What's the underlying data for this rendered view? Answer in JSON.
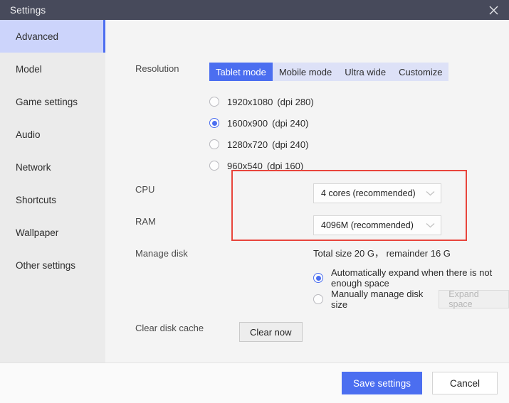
{
  "window": {
    "title": "Settings",
    "close_icon": "close-icon"
  },
  "sidebar": {
    "items": [
      {
        "label": "Advanced",
        "active": true
      },
      {
        "label": "Model",
        "active": false
      },
      {
        "label": "Game settings",
        "active": false
      },
      {
        "label": "Audio",
        "active": false
      },
      {
        "label": "Network",
        "active": false
      },
      {
        "label": "Shortcuts",
        "active": false
      },
      {
        "label": "Wallpaper",
        "active": false
      },
      {
        "label": "Other settings",
        "active": false
      }
    ]
  },
  "main": {
    "resolution": {
      "label": "Resolution",
      "tabs": [
        {
          "label": "Tablet mode",
          "active": true
        },
        {
          "label": "Mobile mode",
          "active": false
        },
        {
          "label": "Ultra wide",
          "active": false
        },
        {
          "label": "Customize",
          "active": false
        }
      ],
      "options": [
        {
          "size": "1920x1080",
          "dpi": "(dpi 280)",
          "selected": false
        },
        {
          "size": "1600x900",
          "dpi": "(dpi 240)",
          "selected": true
        },
        {
          "size": "1280x720",
          "dpi": "(dpi 240)",
          "selected": false
        },
        {
          "size": "960x540",
          "dpi": "(dpi 160)",
          "selected": false
        }
      ]
    },
    "cpu": {
      "label": "CPU",
      "value": "4 cores (recommended)"
    },
    "ram": {
      "label": "RAM",
      "value": "4096M (recommended)"
    },
    "manage_disk": {
      "label": "Manage disk",
      "total_text": "Total size 20 G， remainder 16 G",
      "options": [
        {
          "label": "Automatically expand when there is not enough space",
          "selected": true
        },
        {
          "label": "Manually manage disk size",
          "selected": false
        }
      ],
      "expand_button": "Expand space"
    },
    "clear_cache": {
      "label": "Clear disk cache",
      "button": "Clear now"
    }
  },
  "footer": {
    "save_label": "Save settings",
    "cancel_label": "Cancel"
  },
  "colors": {
    "titlebar": "#474a5b",
    "accent": "#4b6ef0",
    "sidebar_active": "#ccd4fb",
    "tabstrip": "#dde1f7",
    "annotation_red": "#e8453c"
  }
}
